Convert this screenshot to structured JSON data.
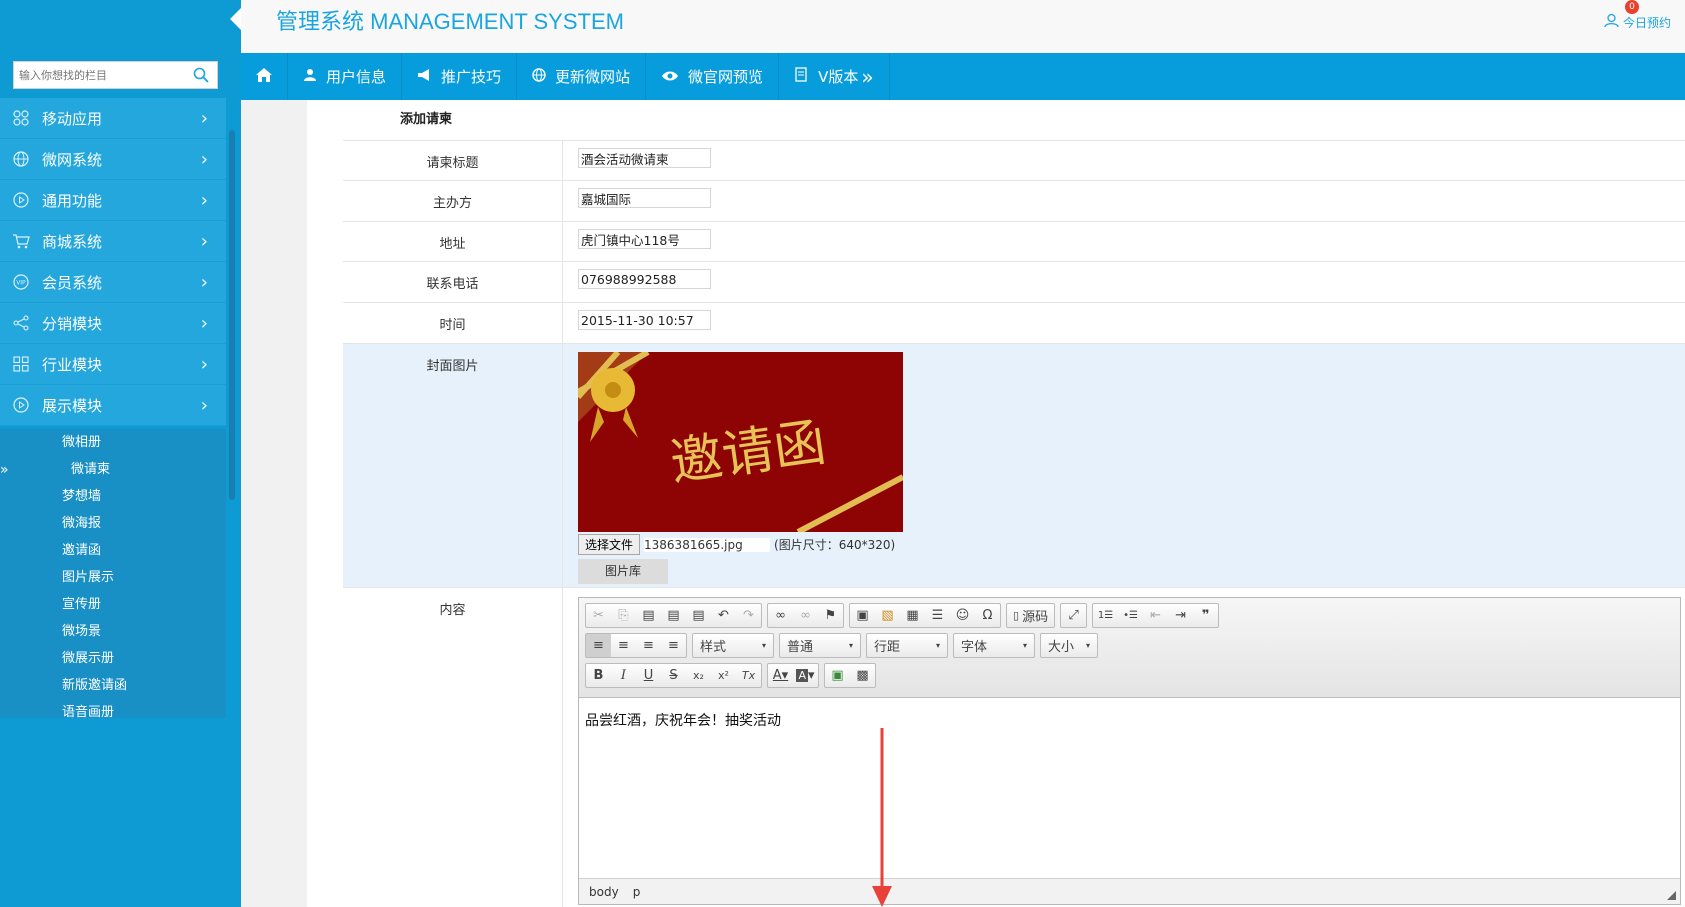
{
  "header": {
    "title": "管理系统 MANAGEMENT SYSTEM",
    "reserve_label": "今日预约",
    "reserve_count": "0"
  },
  "sidebar": {
    "search_placeholder": "输入你想找的栏目",
    "menu": [
      {
        "label": "移动应用",
        "icon": "apps-icon"
      },
      {
        "label": "微网系统",
        "icon": "globe-icon"
      },
      {
        "label": "通用功能",
        "icon": "play-icon"
      },
      {
        "label": "商城系统",
        "icon": "cart-icon"
      },
      {
        "label": "会员系统",
        "icon": "vip-icon"
      },
      {
        "label": "分销模块",
        "icon": "share-icon"
      },
      {
        "label": "行业模块",
        "icon": "grid-icon"
      },
      {
        "label": "展示模块",
        "icon": "play-icon"
      }
    ],
    "submenu": [
      "微相册",
      "微请柬",
      "梦想墙",
      "微海报",
      "邀请函",
      "图片展示",
      "宣传册",
      "微场景",
      "微展示册",
      "新版邀请函",
      "语音画册"
    ],
    "active_sub": "微请柬",
    "active_marker": "»"
  },
  "topnav": {
    "items": [
      {
        "label": "用户信息",
        "icon": "user-icon"
      },
      {
        "label": "推广技巧",
        "icon": "megaphone-icon"
      },
      {
        "label": "更新微网站",
        "icon": "globe-icon"
      },
      {
        "label": "微官网预览",
        "icon": "eye-icon"
      },
      {
        "label": "V版本",
        "icon": "version-icon"
      }
    ],
    "more": "»"
  },
  "form": {
    "title": "添加请柬",
    "fields": [
      {
        "label": "请柬标题",
        "value": "酒会活动微请柬"
      },
      {
        "label": "主办方",
        "value": "嘉城国际"
      },
      {
        "label": "地址",
        "value": "虎门镇中心118号"
      },
      {
        "label": "联系电话",
        "value": "076988992588"
      },
      {
        "label": "时间",
        "value": "2015-11-30 10:57"
      }
    ],
    "cover": {
      "label": "封面图片",
      "image_text": "邀请函",
      "choose_file": "选择文件",
      "file_name": "1386381665.jpg",
      "size_hint": "(图片尺寸：640*320)",
      "gallery_button": "图片库"
    },
    "content": {
      "label": "内容",
      "text": "品尝红酒，庆祝年会！抽奖活动",
      "footer_path": [
        "body",
        "p"
      ]
    }
  },
  "editor_toolbar": {
    "row1_groups": [
      [
        "✂",
        "⎘",
        "📋",
        "📋",
        "📋",
        "↶",
        "↷"
      ],
      [
        "🔗",
        "⛓",
        "⚑"
      ],
      [
        "🖼",
        "🏞",
        "▦",
        "☰",
        "☺",
        "Ω"
      ],
      [
        "源码"
      ],
      [
        "⤢"
      ],
      [
        "1.",
        "•",
        "⇤",
        "⇥",
        "❞"
      ]
    ],
    "row2_align": [
      "≡",
      "≡",
      "≡",
      "≡"
    ],
    "row2_selects": [
      "样式",
      "普通",
      "行距",
      "字体",
      "大小"
    ],
    "row3_groups": [
      [
        "B",
        "I",
        "U",
        "S",
        "x₂",
        "x²",
        "Tx"
      ],
      [
        "A",
        "A"
      ],
      [
        "🖼",
        "▩"
      ]
    ]
  }
}
